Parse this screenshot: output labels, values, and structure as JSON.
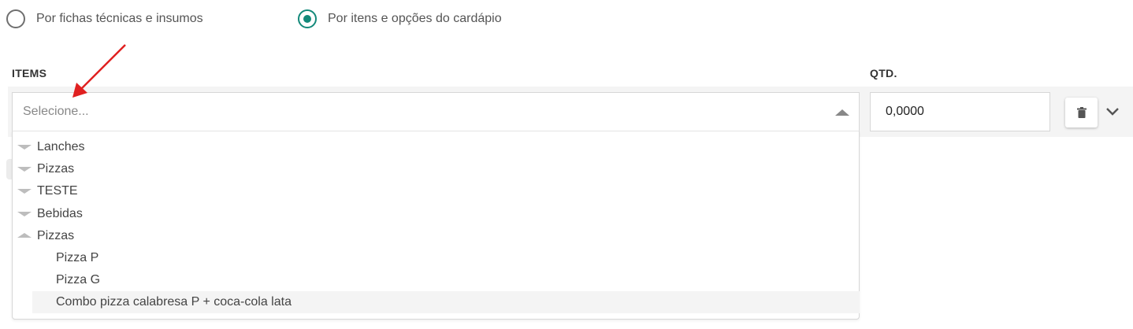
{
  "radio_options": [
    {
      "label": "Por fichas técnicas e insumos",
      "checked": false
    },
    {
      "label": "Por itens e opções do cardápio",
      "checked": true
    }
  ],
  "columns": {
    "items": "ITEMS",
    "qty": "QTD."
  },
  "select": {
    "placeholder": "Selecione..."
  },
  "qty_value": "0,0000",
  "dropdown": {
    "groups": [
      {
        "label": "Lanches",
        "expanded": false
      },
      {
        "label": "Pizzas",
        "expanded": false
      },
      {
        "label": "TESTE",
        "expanded": false
      },
      {
        "label": "Bebidas",
        "expanded": false
      },
      {
        "label": "Pizzas",
        "expanded": true
      }
    ],
    "children": [
      {
        "label": "Pizza P"
      },
      {
        "label": "Pizza G"
      },
      {
        "label": "Combo pizza calabresa P + coca-cola lata",
        "highlighted": true
      }
    ]
  },
  "icons": {
    "trash": "trash-icon",
    "chevron": "chevron-down-icon",
    "caret": "caret-up-icon"
  },
  "colors": {
    "accent": "#13897a",
    "annotation_arrow": "#e02020"
  }
}
